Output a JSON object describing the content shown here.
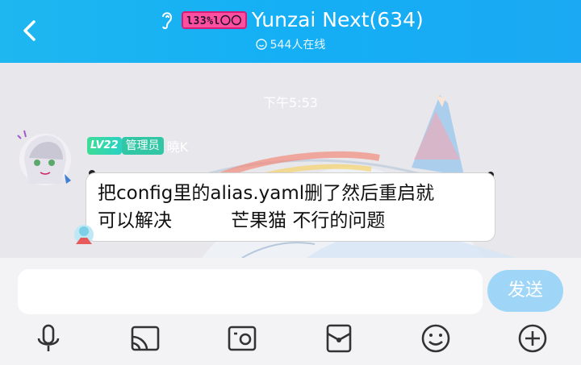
{
  "header": {
    "group_name": "Yunzai Next(634)",
    "online_count": "544人在线",
    "logo_text": "l33%l〇〇",
    "bg_color": "#14aff5"
  },
  "chat": {
    "time_label": "下午5:53",
    "message": {
      "level": "LV22",
      "role": "管理员",
      "sender": "曉K",
      "line1": "把config里的alias.yaml删了然后重启就",
      "line2": "可以解决          芒果猫 不行的问题"
    }
  },
  "input_bar": {
    "placeholder": "",
    "send_label": "发送",
    "tools": [
      "microphone-icon",
      "screen-cast-icon",
      "photo-icon",
      "red-packet-icon",
      "emoji-icon",
      "plus-icon"
    ]
  }
}
